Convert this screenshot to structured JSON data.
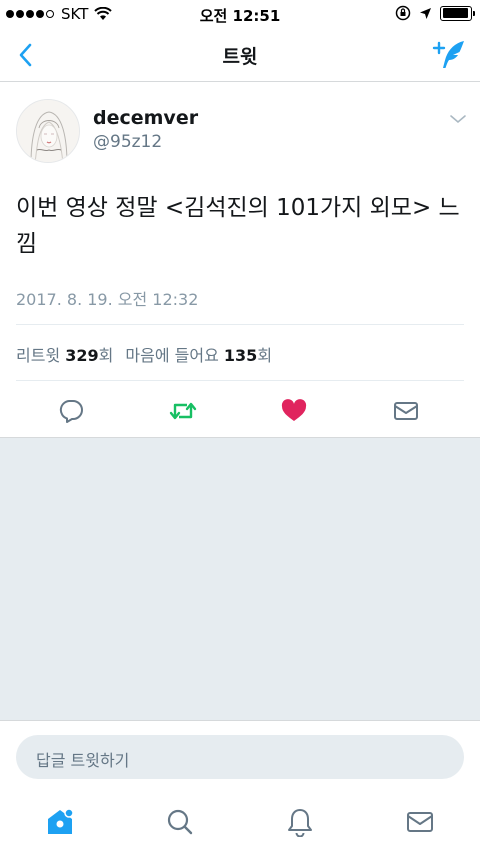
{
  "status_bar": {
    "carrier": "SKT",
    "time": "오전 12:51",
    "battery_level": 0.95
  },
  "nav": {
    "title": "트윗",
    "back_icon": "chevron-left-icon",
    "compose_icon": "compose-tweet-icon"
  },
  "tweet": {
    "display_name": "decemver",
    "handle": "@95z12",
    "text": "이번 영상 정말 <김석진의 101가지 외모> 느낌",
    "timestamp": "2017. 8. 19. 오전 12:32",
    "stats": {
      "retweet_label": "리트윗",
      "retweet_count": "329",
      "retweet_unit": "회",
      "like_label": "마음에 들어요",
      "like_count": "135",
      "like_unit": "회"
    },
    "actions": {
      "reply_icon": "reply-icon",
      "retweet_icon": "retweet-icon",
      "like_icon": "heart-icon",
      "dm_icon": "mail-icon"
    }
  },
  "reply_bar": {
    "placeholder": "답글 트윗하기"
  },
  "tab_bar": {
    "items": [
      "home-icon",
      "search-icon",
      "notifications-icon",
      "messages-icon"
    ]
  },
  "colors": {
    "accent": "#1da1f2",
    "retweet": "#17bf63",
    "like": "#e0245e",
    "icon_gray": "#657786"
  }
}
